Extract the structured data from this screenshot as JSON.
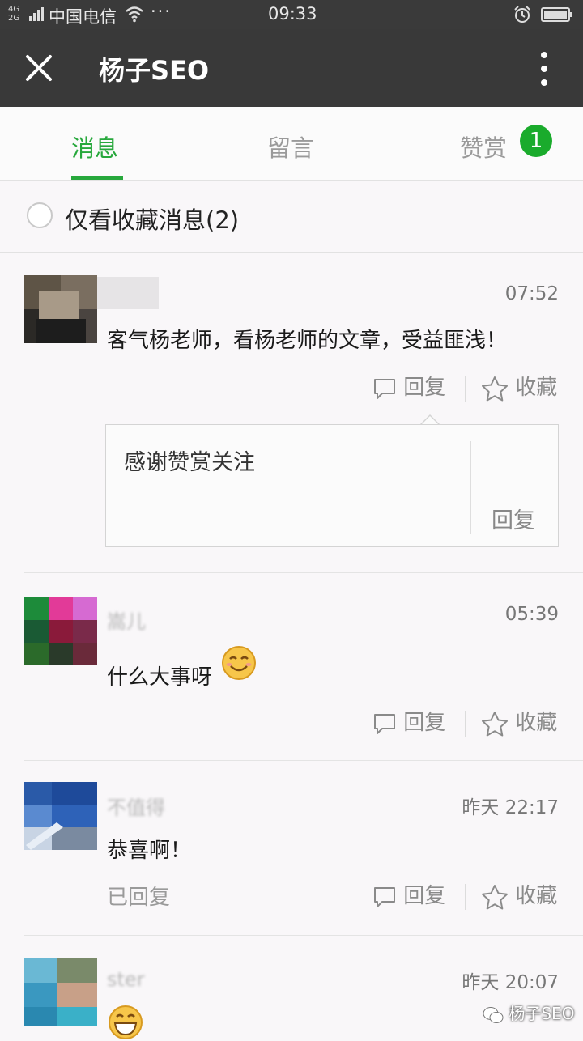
{
  "status_bar": {
    "network": "4G\n2G",
    "carrier": "中国电信",
    "more": "···",
    "time": "09:33"
  },
  "header": {
    "title": "杨子SEO"
  },
  "tabs": [
    {
      "label": "消息",
      "active": true
    },
    {
      "label": "留言",
      "active": false
    },
    {
      "label": "赞赏",
      "active": false,
      "badge": "1"
    }
  ],
  "filter": {
    "label": "仅看收藏消息(2)"
  },
  "actions": {
    "reply": "回复",
    "favorite": "收藏"
  },
  "comments": [
    {
      "time": "07:52",
      "content": "客气杨老师，看杨老师的文章，受益匪浅！",
      "author_reply": {
        "text": "感谢赞赏关注",
        "reply_button": "回复"
      }
    },
    {
      "name": "嵩儿",
      "time": "05:39",
      "content": "什么大事呀"
    },
    {
      "name": "不值得",
      "time": "昨天 22:17",
      "content": "恭喜啊！",
      "status": "已回复"
    },
    {
      "name": "ster",
      "time": "昨天 20:07"
    }
  ],
  "watermark": "杨子SEO",
  "colors": {
    "accent_green": "#27a83c",
    "header_bg": "#393939",
    "statusbar_bg": "#3a3a3a"
  }
}
